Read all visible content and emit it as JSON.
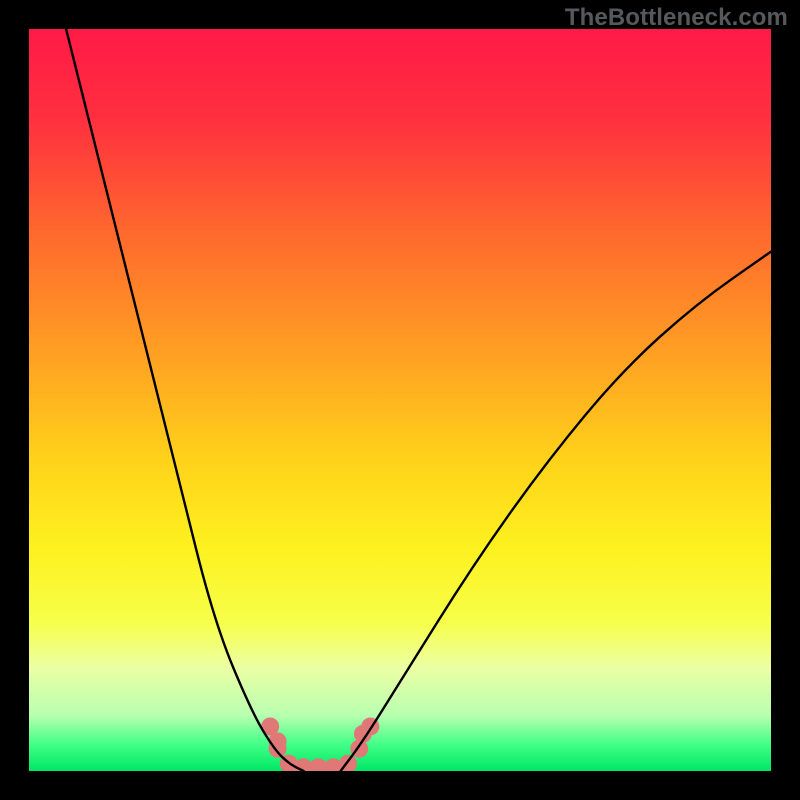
{
  "watermark": "TheBottleneck.com",
  "chart_data": {
    "type": "line",
    "title": "",
    "xlabel": "",
    "ylabel": "",
    "xlim": [
      0,
      100
    ],
    "ylim": [
      0,
      100
    ],
    "series": [
      {
        "name": "left-curve",
        "x": [
          5,
          10,
          15,
          20,
          25,
          30,
          33,
          35,
          37
        ],
        "y": [
          100,
          80,
          60,
          40,
          20,
          8,
          3,
          1,
          0
        ]
      },
      {
        "name": "right-curve",
        "x": [
          42,
          45,
          50,
          60,
          70,
          80,
          90,
          100
        ],
        "y": [
          0,
          4,
          12,
          28,
          42,
          54,
          63,
          70
        ]
      }
    ],
    "valley_markers": {
      "name": "valley-dots",
      "points": [
        {
          "x": 32.5,
          "y": 6
        },
        {
          "x": 33.5,
          "y": 4
        },
        {
          "x": 33.5,
          "y": 3
        },
        {
          "x": 35,
          "y": 1
        },
        {
          "x": 37,
          "y": 0.5
        },
        {
          "x": 39,
          "y": 0.5
        },
        {
          "x": 41,
          "y": 0.5
        },
        {
          "x": 43,
          "y": 1
        },
        {
          "x": 44.5,
          "y": 3
        },
        {
          "x": 45,
          "y": 5
        },
        {
          "x": 46,
          "y": 6
        }
      ],
      "color": "#e07878",
      "radius": 9
    },
    "gradient_stops": [
      {
        "offset": 0.0,
        "color": "#ff1a47"
      },
      {
        "offset": 0.12,
        "color": "#ff2f3f"
      },
      {
        "offset": 0.28,
        "color": "#ff6a2d"
      },
      {
        "offset": 0.45,
        "color": "#ffa422"
      },
      {
        "offset": 0.58,
        "color": "#ffd21a"
      },
      {
        "offset": 0.7,
        "color": "#fdf11f"
      },
      {
        "offset": 0.8,
        "color": "#f6ff4a"
      },
      {
        "offset": 0.86,
        "color": "#ecffa4"
      },
      {
        "offset": 0.925,
        "color": "#b8ffb0"
      },
      {
        "offset": 0.965,
        "color": "#3fff85"
      },
      {
        "offset": 1.0,
        "color": "#00e765"
      }
    ]
  }
}
